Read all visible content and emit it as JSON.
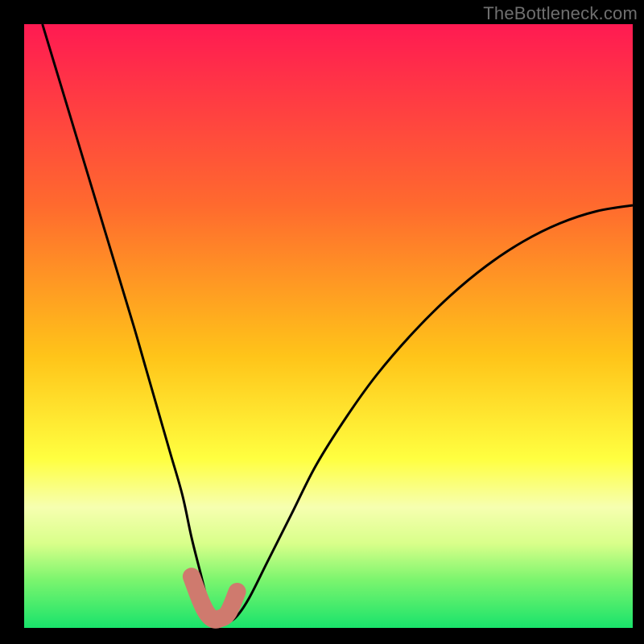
{
  "watermark": "TheBottleneck.com",
  "chart_data": {
    "type": "line",
    "title": "",
    "xlabel": "",
    "ylabel": "",
    "xlim": [
      0,
      100
    ],
    "ylim": [
      0,
      100
    ],
    "grid": false,
    "legend": false,
    "background_gradient": {
      "stops": [
        {
          "offset": 0.0,
          "color": "#ff1a52"
        },
        {
          "offset": 0.3,
          "color": "#ff6a2e"
        },
        {
          "offset": 0.55,
          "color": "#ffc419"
        },
        {
          "offset": 0.72,
          "color": "#ffff40"
        },
        {
          "offset": 0.8,
          "color": "#f6ffb0"
        },
        {
          "offset": 0.86,
          "color": "#d9ff8a"
        },
        {
          "offset": 0.92,
          "color": "#7cf56e"
        },
        {
          "offset": 1.0,
          "color": "#19e36b"
        }
      ]
    },
    "series": [
      {
        "name": "bottleneck-curve",
        "color": "#000000",
        "stroke_width": 3,
        "x": [
          3,
          6,
          9,
          12,
          15,
          18,
          20,
          22,
          24,
          26,
          27.5,
          29,
          30,
          31,
          32,
          33.5,
          35,
          37,
          40,
          44,
          48,
          53,
          58,
          64,
          70,
          76,
          82,
          88,
          94,
          100
        ],
        "y": [
          100,
          90,
          80,
          70,
          60,
          50,
          43,
          36,
          29,
          22,
          15,
          9,
          5,
          2,
          1,
          1,
          2,
          5,
          11,
          19,
          27,
          35,
          42,
          49,
          55,
          60,
          64,
          67,
          69,
          70
        ]
      },
      {
        "name": "highlight-segment",
        "color": "#cf7a6e",
        "stroke_width": 22,
        "linecap": "round",
        "x": [
          27.5,
          29,
          30,
          31,
          32,
          33.5,
          35
        ],
        "y": [
          8.5,
          4.5,
          2.5,
          1.5,
          1.5,
          2.5,
          6.0
        ]
      }
    ],
    "annotations": []
  }
}
